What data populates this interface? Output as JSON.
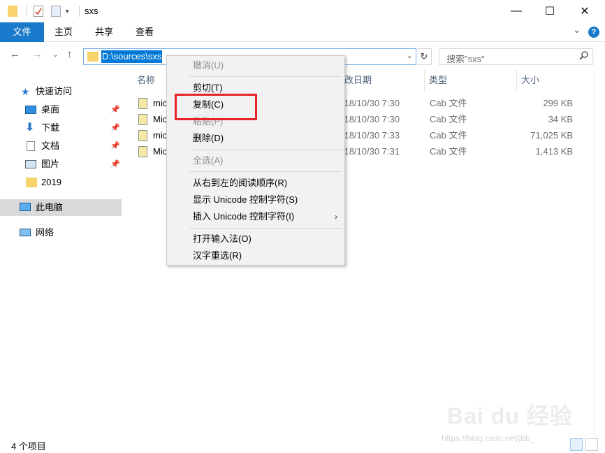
{
  "window": {
    "title": "sxs"
  },
  "window_buttons": {
    "minimize": "—",
    "maximize": "☐",
    "close": "✕"
  },
  "ribbon": {
    "tabs": [
      "文件",
      "主页",
      "共享",
      "查看"
    ],
    "expand_chevron": "⌄"
  },
  "help_icon": "?",
  "address_bar": {
    "path": "D:\\sources\\sxs"
  },
  "search": {
    "placeholder": "搜索\"sxs\""
  },
  "sidebar": {
    "items": [
      {
        "label": "快速访问",
        "icon": "star-icon"
      },
      {
        "label": "桌面",
        "icon": "desktop-icon"
      },
      {
        "label": "下载",
        "icon": "download-icon"
      },
      {
        "label": "文档",
        "icon": "document-icon"
      },
      {
        "label": "图片",
        "icon": "picture-icon"
      },
      {
        "label": "2019",
        "icon": "folder-icon"
      },
      {
        "label": "此电脑",
        "icon": "computer-icon"
      },
      {
        "label": "网络",
        "icon": "network-icon"
      }
    ]
  },
  "file_list": {
    "headers": {
      "name": "名称",
      "date": "修改日期",
      "type": "类型",
      "size": "大小"
    },
    "rows": [
      {
        "name": "mic",
        "date": "2018/10/30 7:30",
        "type": "Cab 文件",
        "size": "299 KB"
      },
      {
        "name": "Mic",
        "date": "2018/10/30 7:30",
        "type": "Cab 文件",
        "size": "34 KB"
      },
      {
        "name": "mic",
        "date": "2018/10/30 7:33",
        "type": "Cab 文件",
        "size": "71,025 KB"
      },
      {
        "name": "Mic",
        "date": "2018/10/30 7:31",
        "type": "Cab 文件",
        "size": "1,413 KB"
      }
    ]
  },
  "context_menu": {
    "undo": "撤消(U)",
    "cut": "剪切(T)",
    "copy": "复制(C)",
    "paste": "粘贴(P)",
    "delete": "删除(D)",
    "select_all": "全选(A)",
    "rtl": "从右到左的阅读顺序(R)",
    "show_unicode": "显示 Unicode 控制字符(S)",
    "insert_unicode": "插入 Unicode 控制字符(I)",
    "open_ime": "打开输入法(O)",
    "reconversion": "汉字重选(R)",
    "submenu_arrow": "›"
  },
  "status_bar": {
    "item_count": "4 个项目"
  },
  "watermark": {
    "logo": "Bai du 经验",
    "url": "https://blog.csdn.net/jbb_"
  },
  "colors": {
    "accent": "#1979ca",
    "selection": "#0078d7",
    "highlight": "#e8232a"
  }
}
